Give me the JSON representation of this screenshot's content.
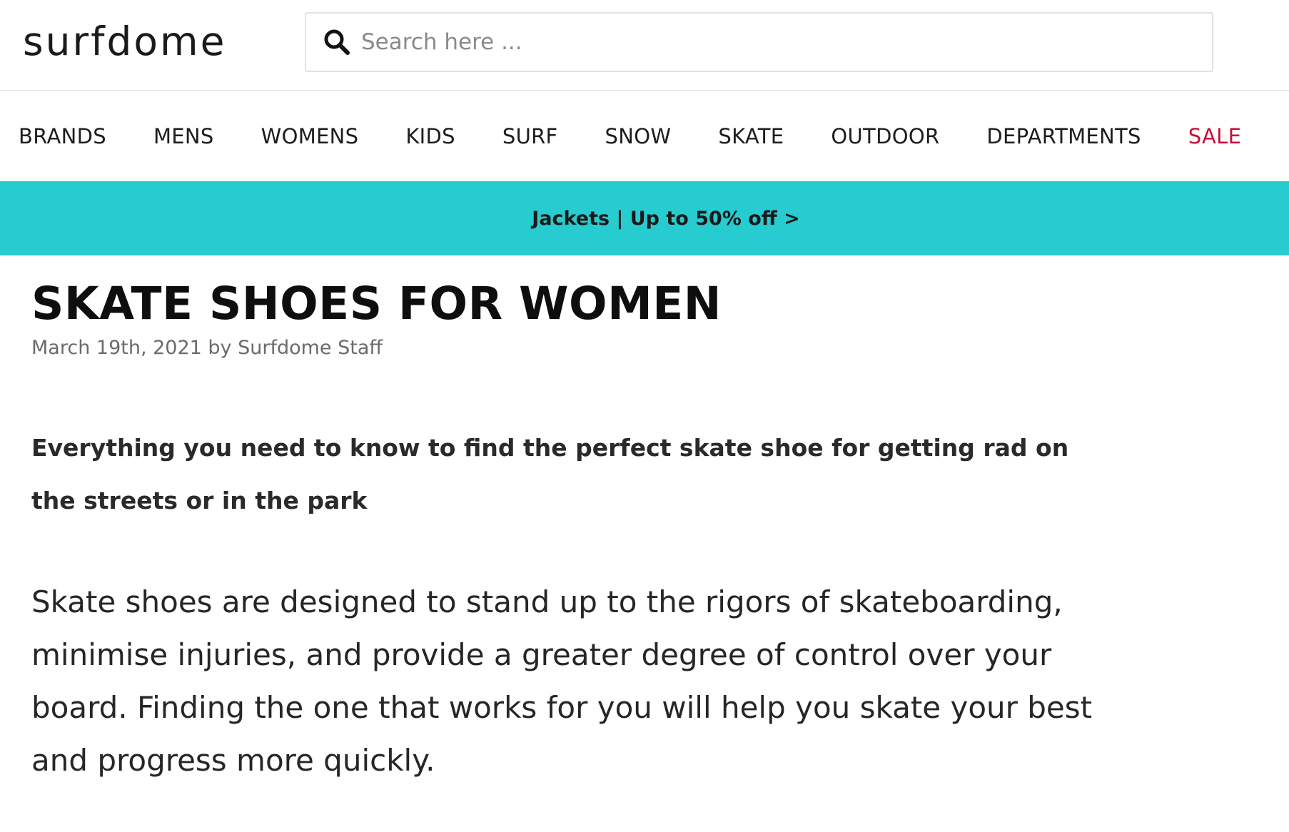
{
  "header": {
    "logo": "surfdome",
    "search_placeholder": "Search here ..."
  },
  "nav": {
    "items": [
      "BRANDS",
      "MENS",
      "WOMENS",
      "KIDS",
      "SURF",
      "SNOW",
      "SKATE",
      "OUTDOOR",
      "DEPARTMENTS"
    ],
    "sale": "SALE"
  },
  "promo": {
    "text": "Jackets | Up to 50% off >"
  },
  "article": {
    "title": "SKATE SHOES FOR WOMEN",
    "meta": "March 19th, 2021 by Surfdome Staff",
    "intro": "Everything you need to know to find the perfect skate shoe for getting rad on the streets or in the park",
    "body": "Skate shoes are designed to stand up to the rigors of skateboarding, minimise injuries, and provide a greater degree of control over your board. Finding the one that works for you will help you skate your best and progress more quickly."
  },
  "colors": {
    "promo_bg": "#26cccf",
    "sale": "#c8103e"
  }
}
